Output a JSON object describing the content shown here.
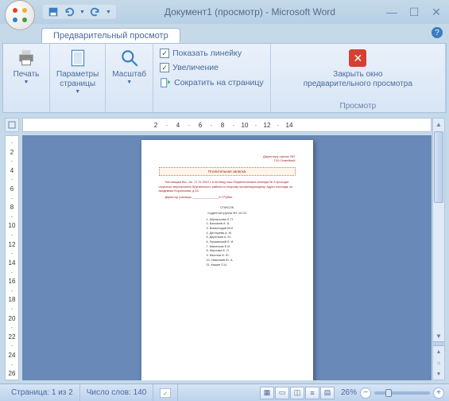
{
  "title": "Документ1 (просмотр) - Microsoft Word",
  "tab": {
    "label": "Предварительный просмотр"
  },
  "ribbon": {
    "print": {
      "label": "Печать"
    },
    "page_setup": {
      "label": "Параметры\nстраницы"
    },
    "zoom": {
      "label": "Масштаб"
    },
    "show_ruler": {
      "label": "Показать линейку",
      "checked": true
    },
    "magnifier": {
      "label": "Увеличение",
      "checked": true
    },
    "shrink": {
      "label": "Сократить на страницу"
    },
    "close": {
      "label": "Закрыть окно\nпредварительного просмотра"
    },
    "group_label": "Просмотр"
  },
  "ruler_h": [
    "2",
    "·",
    "4",
    "·",
    "6",
    "·",
    "8",
    "·",
    "10",
    "·",
    "12",
    "·",
    "14"
  ],
  "ruler_v": [
    "·",
    "2",
    "·",
    "4",
    "·",
    "6",
    "·",
    "8",
    "·",
    "10",
    "·",
    "12",
    "·",
    "14",
    "·",
    "16",
    "·",
    "18",
    "·",
    "20",
    "·",
    "22",
    "·",
    "24",
    "·",
    "26"
  ],
  "page": {
    "top_right_1": "Директору школы №7",
    "top_right_2": "Г.Ю.Семейной",
    "header_box": "Поснительная записка",
    "body_1": "Настоящим Вш. чго. 17.11.2010 г. в пятницу наш Педагогическом колледж № 3 проходит открытые мероприятия Фрунзенского района по второму профилирующему. Адрес колледж: ул академика Королькова, д.16.",
    "body_2": "Директор училища ________________К.Г.Рубин",
    "list_title": "СПИСОК",
    "list_sub": "студентов группы МТ-10-03",
    "items": [
      "1. Абрикосова Л. П.",
      "2. Баскаков А. А.",
      "3. Всеволодов М.И.",
      "4. Дегтярева А. М.",
      "5. Дереньев А. М.",
      "6. Лукшинский Л. И.",
      "7. Маленьев Е.И.",
      "8. Маслова Е. Л.",
      "9. Мыслов И. Ю.",
      "10. Николаев Ю. А.",
      "",
      "11. Кашин П.И."
    ]
  },
  "status": {
    "page": "Страница: 1 из 2",
    "words": "Число слов: 140",
    "zoom_value": "26%"
  }
}
